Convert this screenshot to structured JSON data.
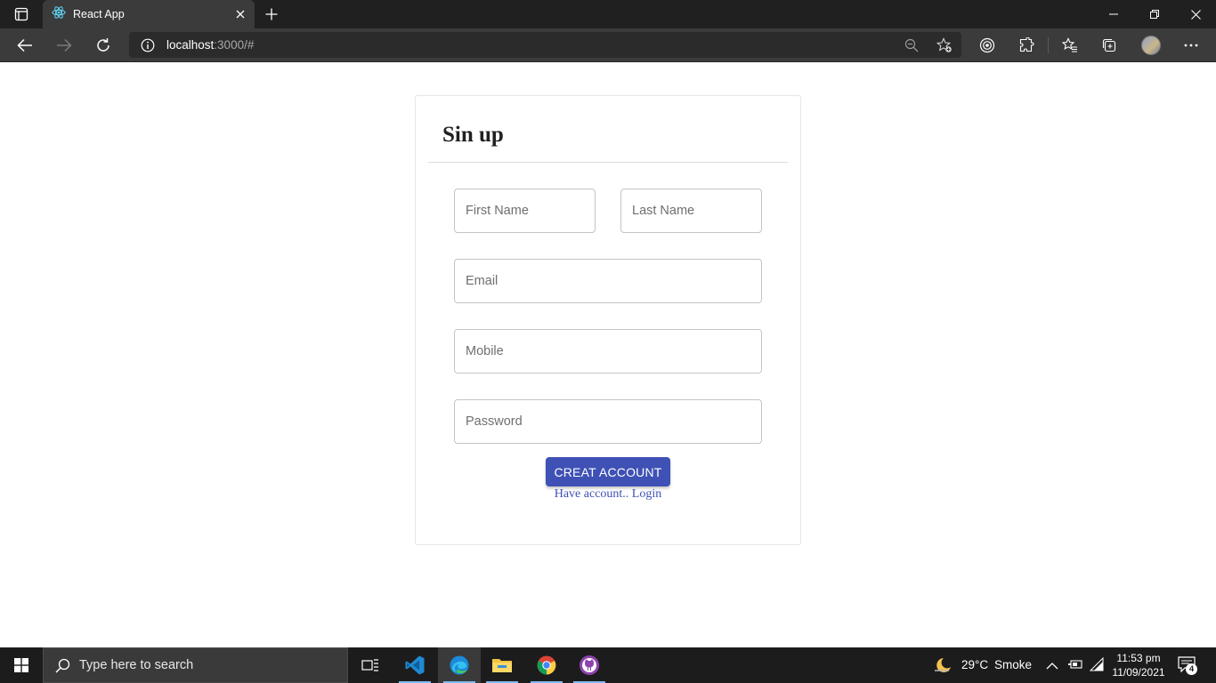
{
  "browser": {
    "tab_title": "React App",
    "url_host": "localhost",
    "url_rest": ":3000/#"
  },
  "signup": {
    "title": "Sin up",
    "first_name_placeholder": "First Name",
    "last_name_placeholder": "Last Name",
    "email_placeholder": "Email",
    "mobile_placeholder": "Mobile",
    "password_placeholder": "Password",
    "create_button_label": "CREAT ACCOUNT",
    "login_link_text": "Have account.. Login"
  },
  "taskbar": {
    "search_placeholder": "Type here to search",
    "weather_temp": "29°C",
    "weather_desc": "Smoke",
    "time": "11:53 pm",
    "date": "11/09/2021",
    "notification_count": "4"
  },
  "colors": {
    "primary": "#3f51b5",
    "chrome_dark": "#202020",
    "chrome_mid": "#3b3b3b"
  }
}
